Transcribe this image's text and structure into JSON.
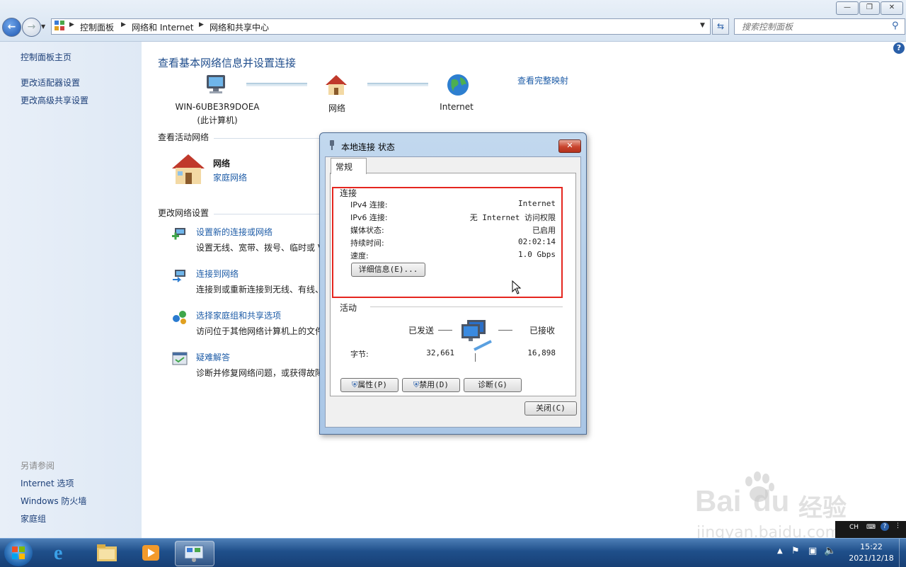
{
  "window": {
    "min": "—",
    "restore": "❐",
    "close": "✕"
  },
  "breadcrumb": {
    "items": [
      "控制面板",
      "网络和 Internet",
      "网络和共享中心"
    ]
  },
  "search": {
    "placeholder": "搜索控制面板"
  },
  "sidebar": {
    "home": "控制面板主页",
    "links": [
      "更改适配器设置",
      "更改高级共享设置"
    ],
    "see_also_title": "另请参阅",
    "see_also": [
      "Internet 选项",
      "Windows 防火墙",
      "家庭组"
    ]
  },
  "main": {
    "title": "查看基本网络信息并设置连接",
    "map_link": "查看完整映射",
    "computer_name": "WIN-6UBE3R9DOEA",
    "computer_sub": "(此计算机)",
    "network_label": "网络",
    "internet_label": "Internet",
    "active_title": "查看活动网络",
    "active_name": "网络",
    "active_type": "家庭网络",
    "change_title": "更改网络设置",
    "tasks": [
      {
        "title": "设置新的连接或网络",
        "desc": "设置无线、宽带、拨号、临时或 V"
      },
      {
        "title": "连接到网络",
        "desc": "连接到或重新连接到无线、有线、"
      },
      {
        "title": "选择家庭组和共享选项",
        "desc": "访问位于其他网络计算机上的文件"
      },
      {
        "title": "疑难解答",
        "desc": "诊断并修复网络问题，或获得故障"
      }
    ]
  },
  "dialog": {
    "title": "本地连接 状态",
    "tab": "常规",
    "connection_title": "连接",
    "rows": [
      {
        "label": "IPv4 连接:",
        "value": "Internet"
      },
      {
        "label": "IPv6 连接:",
        "value": "无 Internet 访问权限"
      },
      {
        "label": "媒体状态:",
        "value": "已启用"
      },
      {
        "label": "持续时间:",
        "value": "02:02:14"
      },
      {
        "label": "速度:",
        "value": "1.0 Gbps"
      }
    ],
    "details_btn": "详细信息(E)...",
    "activity_title": "活动",
    "sent_label": "已发送",
    "recv_label": "已接收",
    "bytes_label": "字节:",
    "bytes_sent": "32,661",
    "bytes_recv": "16,898",
    "properties_btn": "属性(P)",
    "disable_btn": "禁用(D)",
    "diagnose_btn": "诊断(G)",
    "close_btn": "关闭(C)"
  },
  "taskbar": {
    "time": "15:22",
    "date": "2021/12/18",
    "ime": "CH"
  },
  "watermark": {
    "brand": "Bai",
    "brand2": "du",
    "cn": "经验",
    "url": "jingyan.baidu.com"
  },
  "colors": {
    "link": "#1e5ca7",
    "highlight": "#e5261f",
    "taskbar": "#1f4f8a"
  }
}
